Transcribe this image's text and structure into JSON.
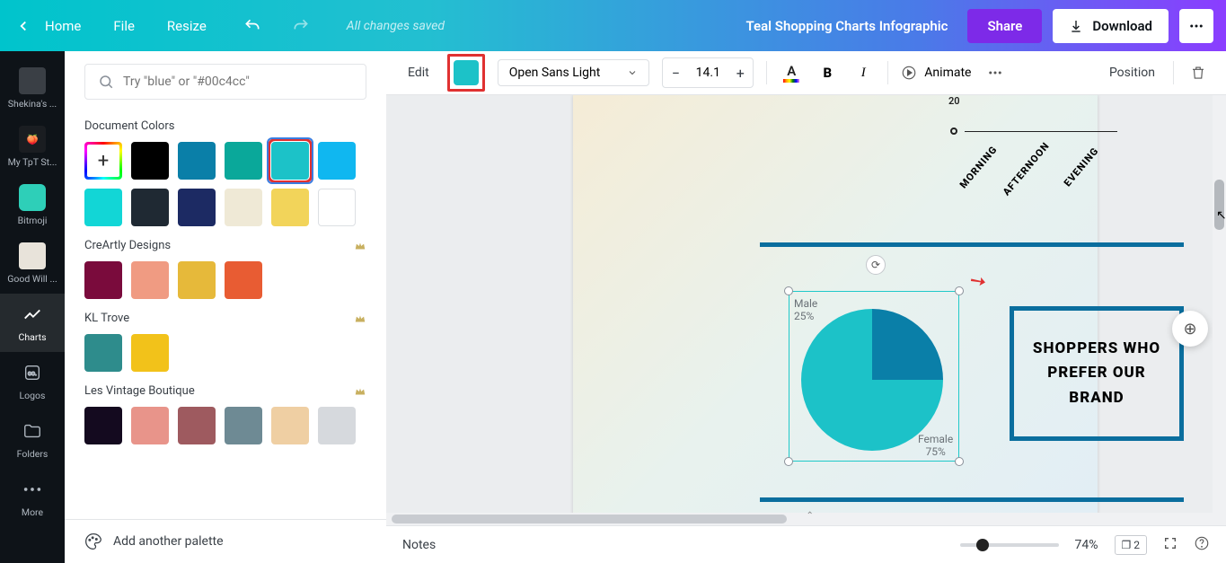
{
  "topbar": {
    "home": "Home",
    "file": "File",
    "resize": "Resize",
    "saved": "All changes saved",
    "title": "Teal Shopping Charts Infographic",
    "share": "Share",
    "download": "Download"
  },
  "leftbar": {
    "items": [
      {
        "label": "Shekina's ..."
      },
      {
        "label": "My TpT St..."
      },
      {
        "label": "Bitmoji"
      },
      {
        "label": "Good Will ..."
      },
      {
        "label": "Charts"
      },
      {
        "label": "Logos"
      },
      {
        "label": "Folders"
      },
      {
        "label": "More"
      }
    ]
  },
  "panel": {
    "search_placeholder": "Try \"blue\" or \"#00c4cc\"",
    "sections": {
      "doc": "Document Colors",
      "creartly": "CreArtly Designs",
      "kl": "KL Trove",
      "les": "Les Vintage Boutique"
    },
    "doc_colors": [
      "#000000",
      "#0a7fa8",
      "#0aa89a",
      "#1cc2c8",
      "#10b7f0",
      "#12d6d6",
      "#1f2933",
      "#1c2a63",
      "#efe9d6",
      "#f2d45a",
      "#ffffff"
    ],
    "creartly": [
      "#7a0b3c",
      "#f09b82",
      "#e6b93a",
      "#e85c33"
    ],
    "kl": [
      "#2e8c8c",
      "#f2c21a"
    ],
    "les": [
      "#140a1f",
      "#e8948a",
      "#9e5a5f",
      "#6e8a94",
      "#efcfa3",
      "#d6d9dd"
    ],
    "selected_color": "#1cc2c8",
    "foot": "Add another palette"
  },
  "toolbar": {
    "edit": "Edit",
    "font": "Open Sans Light",
    "size": "14.1",
    "animate": "Animate",
    "position": "Position"
  },
  "chart_data": {
    "type": "pie",
    "title": "SHOPPERS WHO PREFER OUR BRAND",
    "series": [
      {
        "name": "Male",
        "value": 25,
        "label": "Male",
        "pct": "25%",
        "color": "#0a7fa8"
      },
      {
        "name": "Female",
        "value": 75,
        "label": "Female",
        "pct": "75%",
        "color": "#1cc2c8"
      }
    ],
    "axis_categories": [
      "MORNING",
      "AFTERNOON",
      "EVENING"
    ],
    "axis_tick": "20"
  },
  "footer": {
    "notes": "Notes",
    "zoom": "74%",
    "page": "2"
  }
}
